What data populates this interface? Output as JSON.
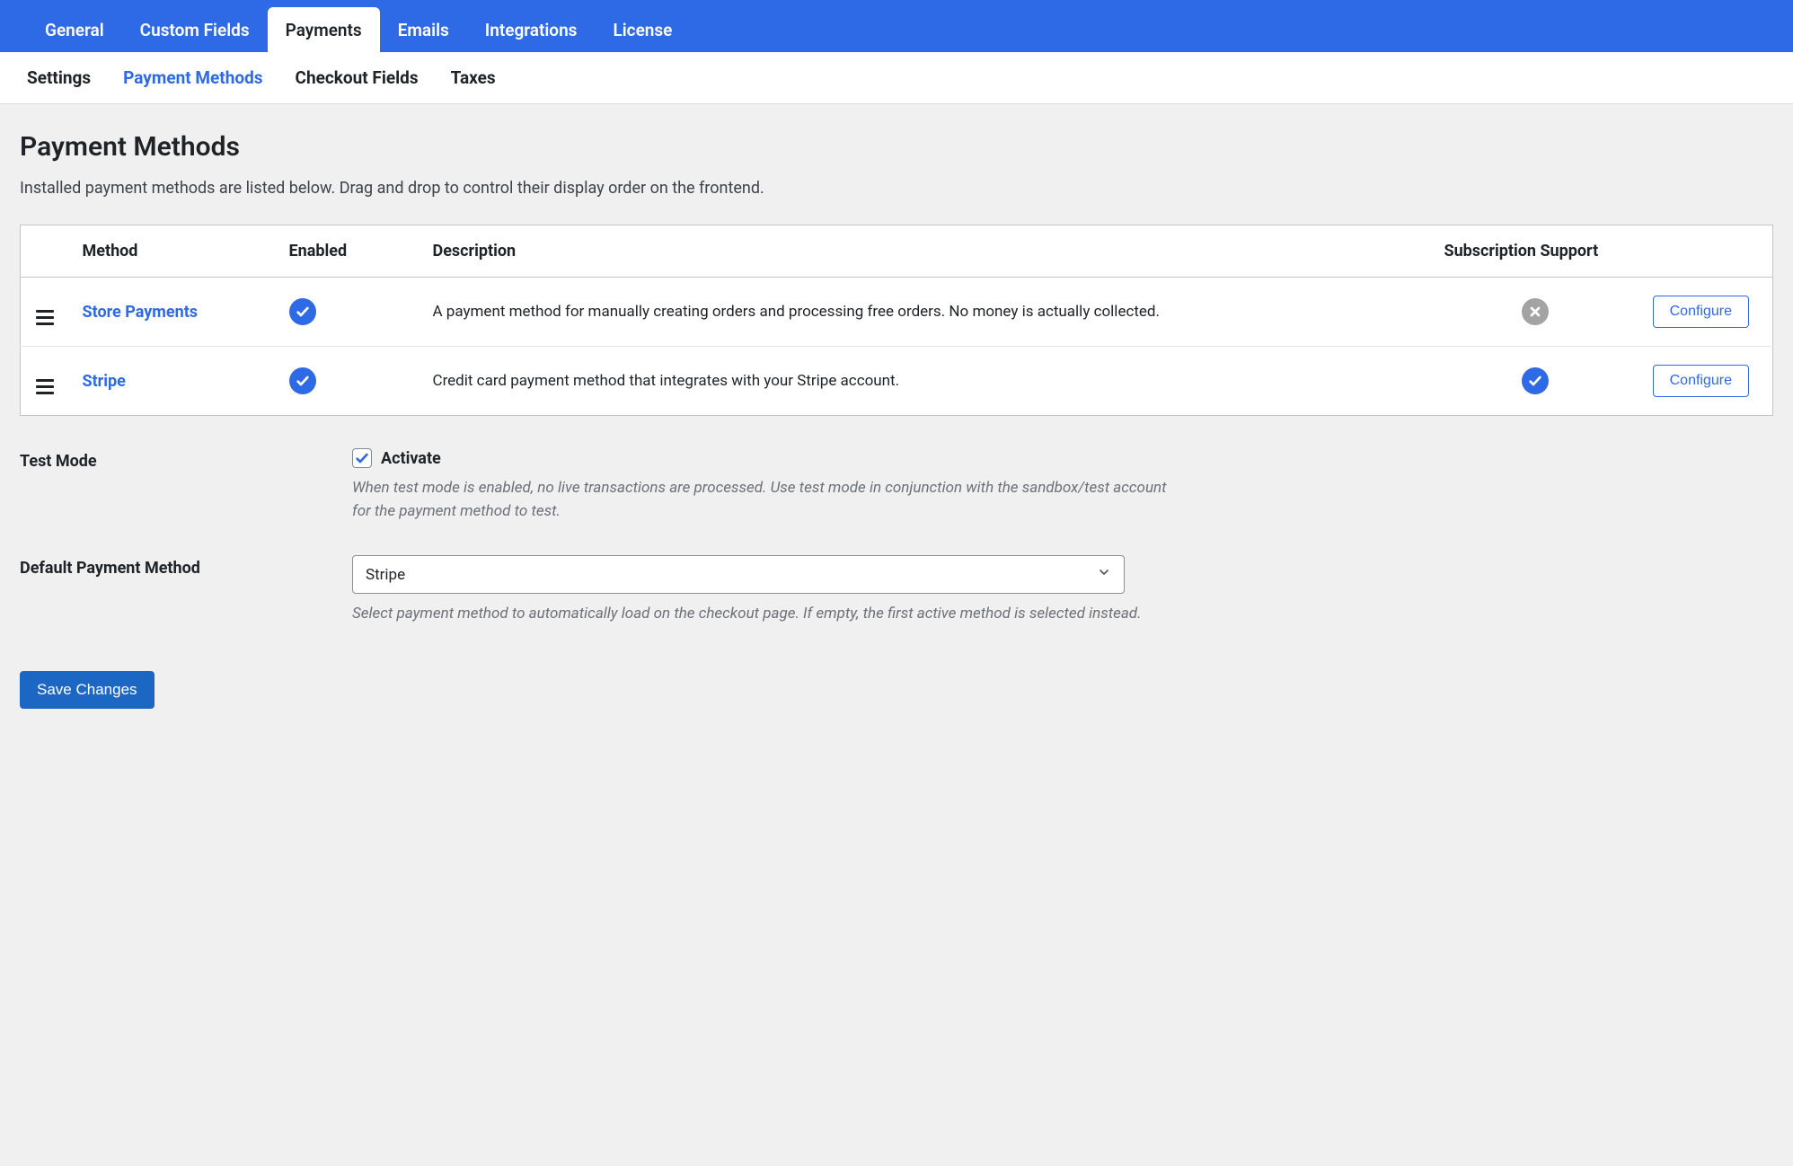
{
  "nav_primary": {
    "items": [
      {
        "label": "General",
        "active": false
      },
      {
        "label": "Custom Fields",
        "active": false
      },
      {
        "label": "Payments",
        "active": true
      },
      {
        "label": "Emails",
        "active": false
      },
      {
        "label": "Integrations",
        "active": false
      },
      {
        "label": "License",
        "active": false
      }
    ]
  },
  "nav_secondary": {
    "items": [
      {
        "label": "Settings",
        "active": false
      },
      {
        "label": "Payment Methods",
        "active": true
      },
      {
        "label": "Checkout Fields",
        "active": false
      },
      {
        "label": "Taxes",
        "active": false
      }
    ]
  },
  "page": {
    "title": "Payment Methods",
    "intro": "Installed payment methods are listed below. Drag and drop to control their display order on the frontend."
  },
  "methods_table": {
    "columns": {
      "method": "Method",
      "enabled": "Enabled",
      "description": "Description",
      "subscription": "Subscription Support"
    },
    "rows": [
      {
        "name": "Store Payments",
        "enabled": true,
        "description": "A payment method for manually creating orders and processing free orders. No money is actually collected.",
        "subscription_support": false,
        "configure_label": "Configure"
      },
      {
        "name": "Stripe",
        "enabled": true,
        "description": "Credit card payment method that integrates with your Stripe account.",
        "subscription_support": true,
        "configure_label": "Configure"
      }
    ]
  },
  "settings": {
    "test_mode": {
      "label": "Test Mode",
      "checkbox_label": "Activate",
      "checked": true,
      "help": "When test mode is enabled, no live transactions are processed. Use test mode in conjunction with the sandbox/test account for the payment method to test."
    },
    "default_method": {
      "label": "Default Payment Method",
      "value": "Stripe",
      "help": "Select payment method to automatically load on the checkout page. If empty, the first active method is selected instead."
    }
  },
  "buttons": {
    "save": "Save Changes"
  }
}
